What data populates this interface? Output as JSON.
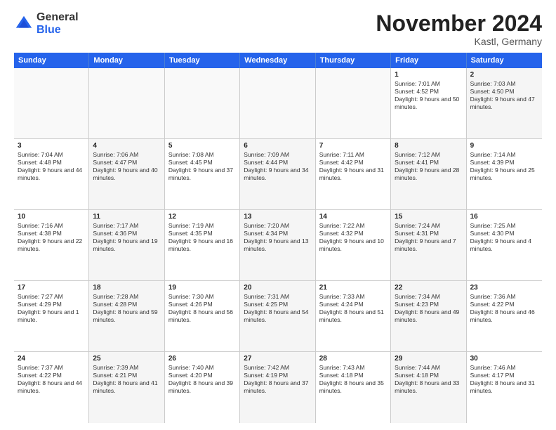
{
  "logo": {
    "general": "General",
    "blue": "Blue"
  },
  "title": "November 2024",
  "location": "Kastl, Germany",
  "headers": [
    "Sunday",
    "Monday",
    "Tuesday",
    "Wednesday",
    "Thursday",
    "Friday",
    "Saturday"
  ],
  "weeks": [
    [
      {
        "day": "",
        "text": "",
        "empty": true
      },
      {
        "day": "",
        "text": "",
        "empty": true
      },
      {
        "day": "",
        "text": "",
        "empty": true
      },
      {
        "day": "",
        "text": "",
        "empty": true
      },
      {
        "day": "",
        "text": "",
        "empty": true
      },
      {
        "day": "1",
        "text": "Sunrise: 7:01 AM\nSunset: 4:52 PM\nDaylight: 9 hours and 50 minutes."
      },
      {
        "day": "2",
        "text": "Sunrise: 7:03 AM\nSunset: 4:50 PM\nDaylight: 9 hours and 47 minutes.",
        "alt": true
      }
    ],
    [
      {
        "day": "3",
        "text": "Sunrise: 7:04 AM\nSunset: 4:48 PM\nDaylight: 9 hours and 44 minutes."
      },
      {
        "day": "4",
        "text": "Sunrise: 7:06 AM\nSunset: 4:47 PM\nDaylight: 9 hours and 40 minutes.",
        "alt": true
      },
      {
        "day": "5",
        "text": "Sunrise: 7:08 AM\nSunset: 4:45 PM\nDaylight: 9 hours and 37 minutes."
      },
      {
        "day": "6",
        "text": "Sunrise: 7:09 AM\nSunset: 4:44 PM\nDaylight: 9 hours and 34 minutes.",
        "alt": true
      },
      {
        "day": "7",
        "text": "Sunrise: 7:11 AM\nSunset: 4:42 PM\nDaylight: 9 hours and 31 minutes."
      },
      {
        "day": "8",
        "text": "Sunrise: 7:12 AM\nSunset: 4:41 PM\nDaylight: 9 hours and 28 minutes.",
        "alt": true
      },
      {
        "day": "9",
        "text": "Sunrise: 7:14 AM\nSunset: 4:39 PM\nDaylight: 9 hours and 25 minutes."
      }
    ],
    [
      {
        "day": "10",
        "text": "Sunrise: 7:16 AM\nSunset: 4:38 PM\nDaylight: 9 hours and 22 minutes."
      },
      {
        "day": "11",
        "text": "Sunrise: 7:17 AM\nSunset: 4:36 PM\nDaylight: 9 hours and 19 minutes.",
        "alt": true
      },
      {
        "day": "12",
        "text": "Sunrise: 7:19 AM\nSunset: 4:35 PM\nDaylight: 9 hours and 16 minutes."
      },
      {
        "day": "13",
        "text": "Sunrise: 7:20 AM\nSunset: 4:34 PM\nDaylight: 9 hours and 13 minutes.",
        "alt": true
      },
      {
        "day": "14",
        "text": "Sunrise: 7:22 AM\nSunset: 4:32 PM\nDaylight: 9 hours and 10 minutes."
      },
      {
        "day": "15",
        "text": "Sunrise: 7:24 AM\nSunset: 4:31 PM\nDaylight: 9 hours and 7 minutes.",
        "alt": true
      },
      {
        "day": "16",
        "text": "Sunrise: 7:25 AM\nSunset: 4:30 PM\nDaylight: 9 hours and 4 minutes."
      }
    ],
    [
      {
        "day": "17",
        "text": "Sunrise: 7:27 AM\nSunset: 4:29 PM\nDaylight: 9 hours and 1 minute."
      },
      {
        "day": "18",
        "text": "Sunrise: 7:28 AM\nSunset: 4:28 PM\nDaylight: 8 hours and 59 minutes.",
        "alt": true
      },
      {
        "day": "19",
        "text": "Sunrise: 7:30 AM\nSunset: 4:26 PM\nDaylight: 8 hours and 56 minutes."
      },
      {
        "day": "20",
        "text": "Sunrise: 7:31 AM\nSunset: 4:25 PM\nDaylight: 8 hours and 54 minutes.",
        "alt": true
      },
      {
        "day": "21",
        "text": "Sunrise: 7:33 AM\nSunset: 4:24 PM\nDaylight: 8 hours and 51 minutes."
      },
      {
        "day": "22",
        "text": "Sunrise: 7:34 AM\nSunset: 4:23 PM\nDaylight: 8 hours and 49 minutes.",
        "alt": true
      },
      {
        "day": "23",
        "text": "Sunrise: 7:36 AM\nSunset: 4:22 PM\nDaylight: 8 hours and 46 minutes."
      }
    ],
    [
      {
        "day": "24",
        "text": "Sunrise: 7:37 AM\nSunset: 4:22 PM\nDaylight: 8 hours and 44 minutes."
      },
      {
        "day": "25",
        "text": "Sunrise: 7:39 AM\nSunset: 4:21 PM\nDaylight: 8 hours and 41 minutes.",
        "alt": true
      },
      {
        "day": "26",
        "text": "Sunrise: 7:40 AM\nSunset: 4:20 PM\nDaylight: 8 hours and 39 minutes."
      },
      {
        "day": "27",
        "text": "Sunrise: 7:42 AM\nSunset: 4:19 PM\nDaylight: 8 hours and 37 minutes.",
        "alt": true
      },
      {
        "day": "28",
        "text": "Sunrise: 7:43 AM\nSunset: 4:18 PM\nDaylight: 8 hours and 35 minutes."
      },
      {
        "day": "29",
        "text": "Sunrise: 7:44 AM\nSunset: 4:18 PM\nDaylight: 8 hours and 33 minutes.",
        "alt": true
      },
      {
        "day": "30",
        "text": "Sunrise: 7:46 AM\nSunset: 4:17 PM\nDaylight: 8 hours and 31 minutes."
      }
    ]
  ]
}
